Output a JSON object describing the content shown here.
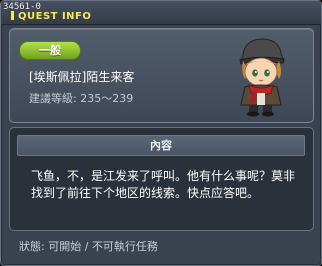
{
  "window": {
    "quest_id": "34561-0",
    "title": "QUEST INFO"
  },
  "quest": {
    "badge": "一般",
    "name": "[埃斯佩拉]陌生来客",
    "level_requirement": "建議等級: 235～239"
  },
  "content": {
    "header": "內容",
    "text": "飞鱼，不，是江发来了呼叫。他有什么事呢？莫非找到了前往下个地区的线索。快点应答吧。"
  },
  "footer": {
    "status": "狀態: 可開始 / 不可執行任務"
  },
  "colors": {
    "title_yellow": "#f4e75a",
    "badge_green": "#8cc234",
    "panel_bg": "#3a4250"
  }
}
